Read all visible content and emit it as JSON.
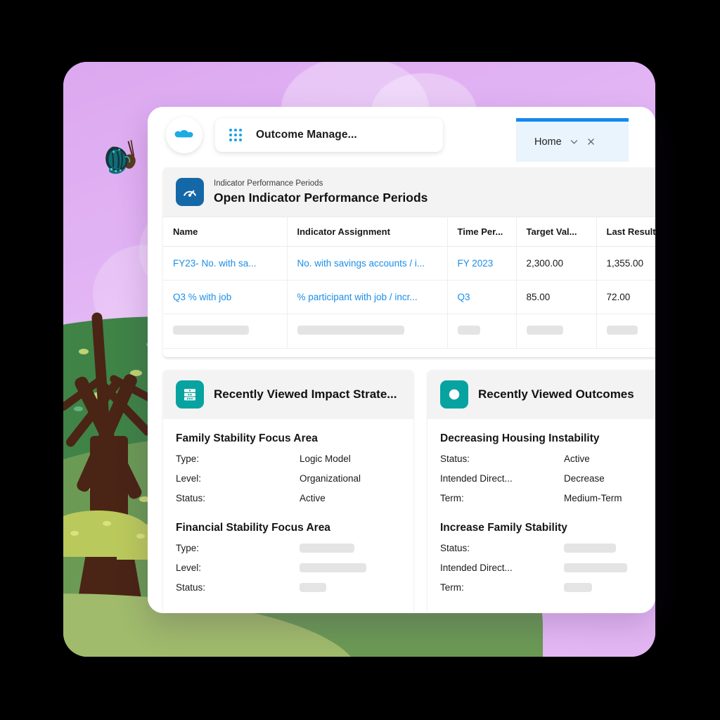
{
  "browser": {
    "app_switcher_label": "Outcome Manage...",
    "waffle_icon": "app-launcher-grid-icon",
    "logo_icon": "salesforce-cloud-icon",
    "tab": {
      "label": "Home",
      "dropdown_icon": "chevron-down-icon",
      "close_icon": "close-x-icon"
    }
  },
  "indicator_card": {
    "icon": "speedometer-gauge-icon",
    "object_label": "Indicator Performance Periods",
    "title": "Open Indicator Performance Periods",
    "columns": [
      "Name",
      "Indicator Assignment",
      "Time Per...",
      "Target Val...",
      "Last Result..."
    ],
    "rows": [
      {
        "name": "FY23- No. with sa...",
        "assignment": "No. with savings accounts / i...",
        "time_period": "FY 2023",
        "target_value": "2,300.00",
        "last_result": "1,355.00"
      },
      {
        "name": "Q3 % with job",
        "assignment": "% participant with job / incr...",
        "time_period": "Q3",
        "target_value": "85.00",
        "last_result": "72.00"
      }
    ],
    "loading_row": {
      "widths": [
        86,
        150,
        30,
        48,
        42
      ]
    }
  },
  "impact_card": {
    "icon": "impact-strategy-stack-icon",
    "title": "Recently Viewed Impact Strate...",
    "items": [
      {
        "title": "Family Stability Focus Area",
        "fields": [
          {
            "key": "Type:",
            "value": "Logic Model"
          },
          {
            "key": "Level:",
            "value": "Organizational"
          },
          {
            "key": "Status:",
            "value": "Active"
          }
        ]
      },
      {
        "title": "Financial Stability Focus Area",
        "fields": [
          {
            "key": "Type:",
            "value": "",
            "skeleton": 78
          },
          {
            "key": "Level:",
            "value": "",
            "skeleton": 95
          },
          {
            "key": "Status:",
            "value": "",
            "skeleton": 38
          }
        ]
      }
    ]
  },
  "outcomes_card": {
    "icon": "outcome-circle-icon",
    "title": "Recently Viewed Outcomes",
    "items": [
      {
        "title": "Decreasing Housing Instability",
        "fields": [
          {
            "key": "Status:",
            "value": "Active"
          },
          {
            "key": "Intended Direct...",
            "value": "Decrease"
          },
          {
            "key": "Term:",
            "value": "Medium-Term"
          }
        ]
      },
      {
        "title": "Increase Family Stability",
        "fields": [
          {
            "key": "Status:",
            "value": "",
            "skeleton": 74
          },
          {
            "key": "Intended Direct...",
            "value": "",
            "skeleton": 90
          },
          {
            "key": "Term:",
            "value": "",
            "skeleton": 40
          }
        ]
      }
    ]
  },
  "illustration": {
    "scene": "butterfly-tree-hills-clouds",
    "colors": {
      "sky": "#e2b4f2",
      "cloud": "#f0d6fa",
      "hill_dark": "#3f8347",
      "hill_mid": "#6b9a55",
      "hill_light": "#9fbb6b",
      "trunk": "#4a2415",
      "butterfly": "#0d6f77"
    }
  },
  "theme": {
    "blue": "#1468a8",
    "teal": "#07a3a0",
    "link": "#1b8ee8",
    "tab_accent": "#1589ee"
  }
}
